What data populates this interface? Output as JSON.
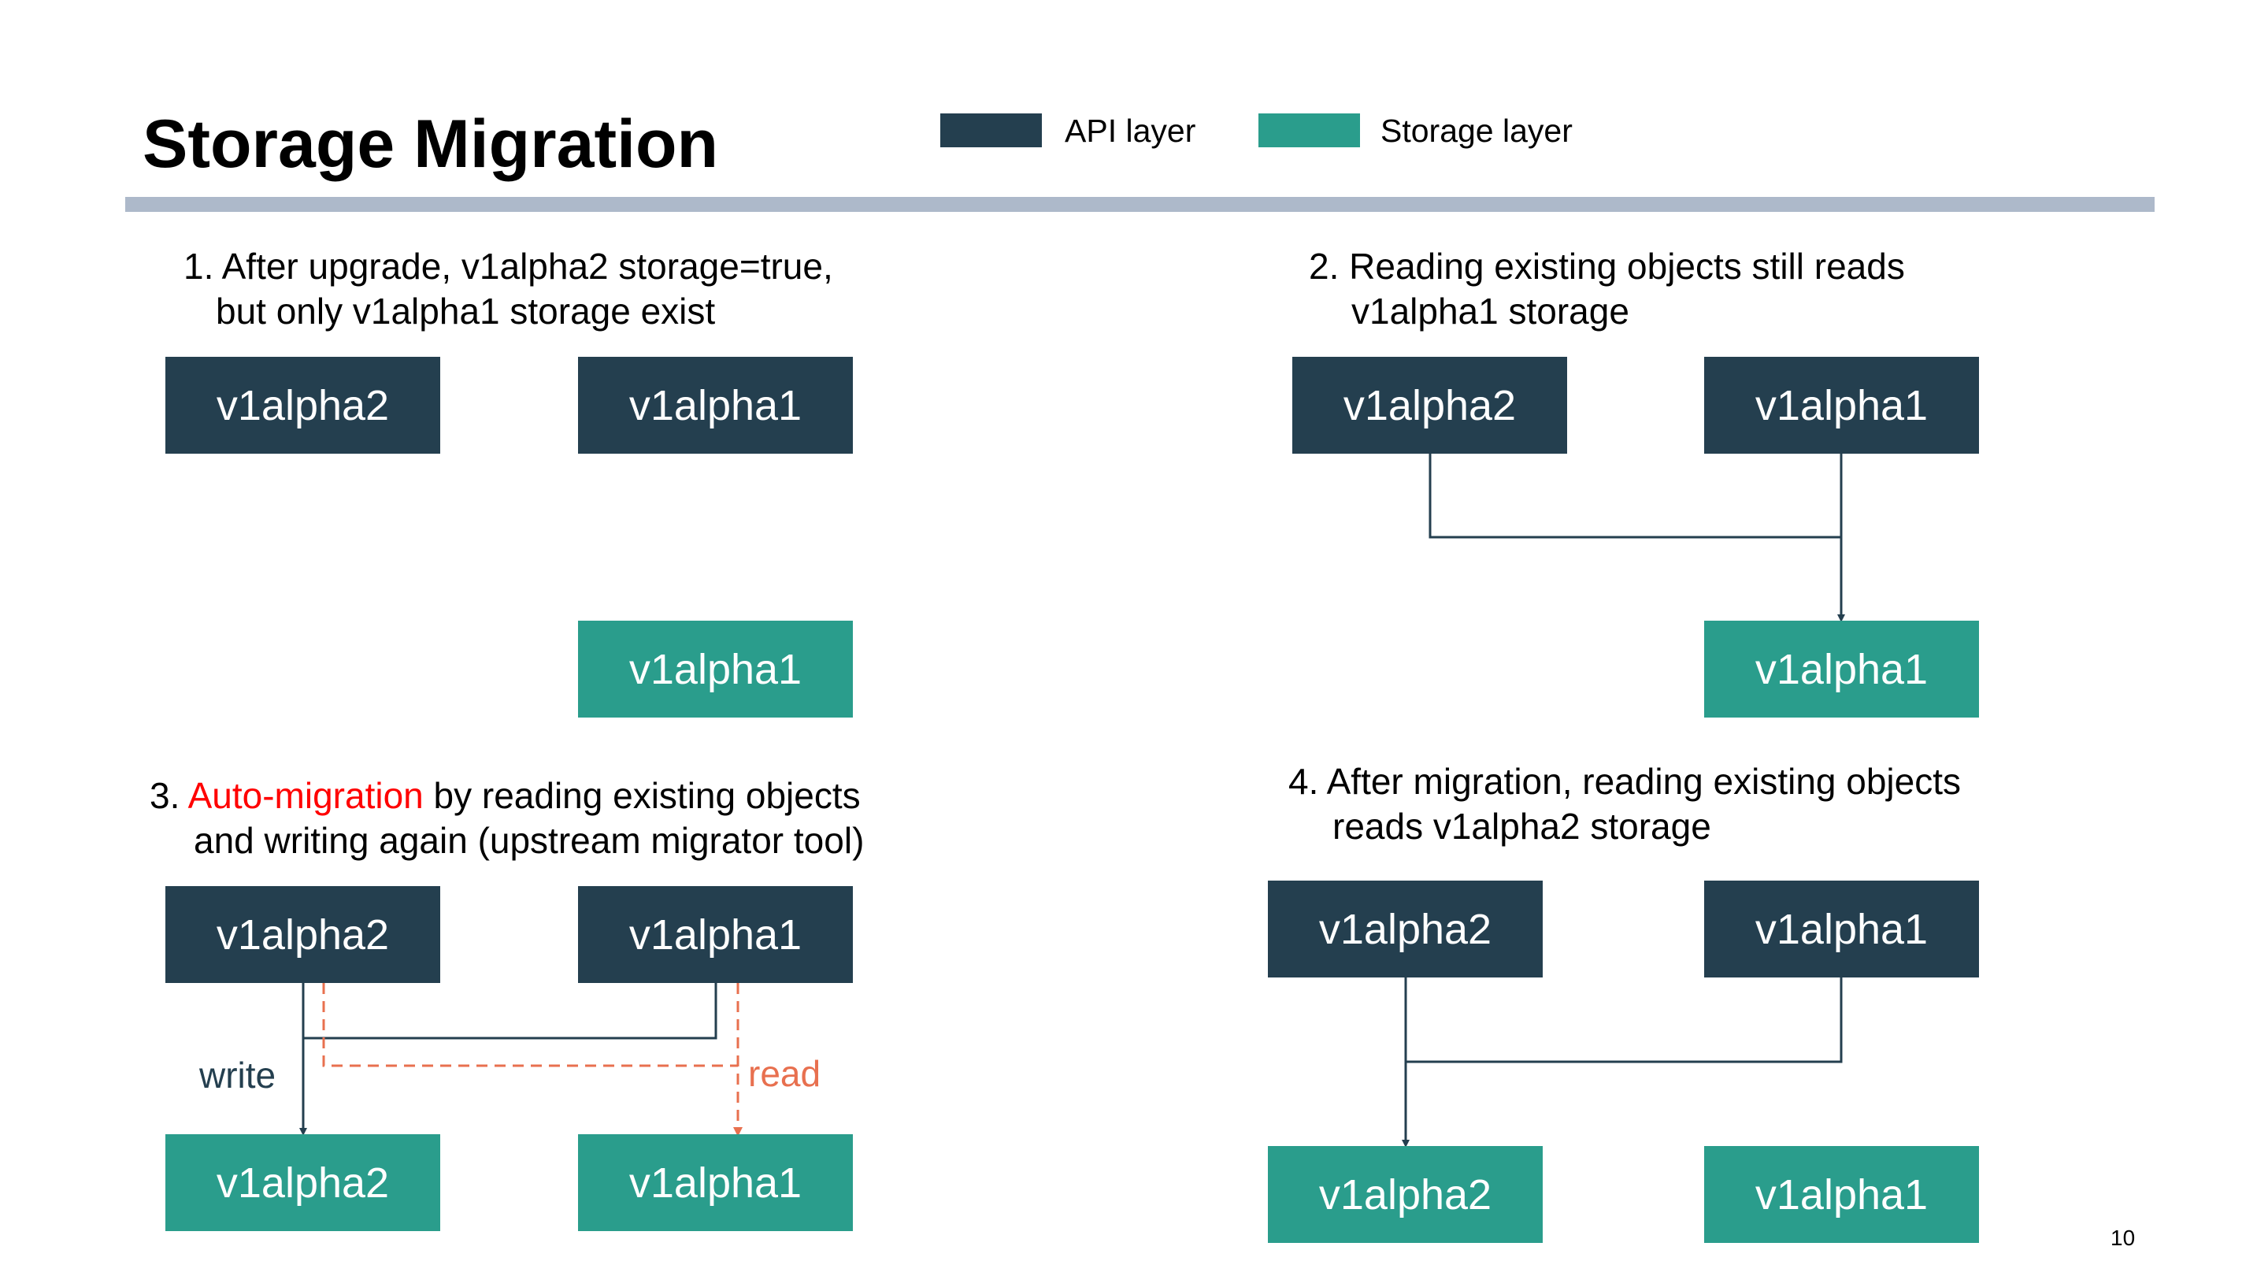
{
  "title": "Storage Migration",
  "legend": [
    {
      "label": "API layer",
      "color": "#243f4f"
    },
    {
      "label": "Storage layer",
      "color": "#2a9d8c"
    }
  ],
  "colors": {
    "api_layer": "#243f4f",
    "storage_layer": "#2a9d8c",
    "rule": "#adb9ca",
    "highlight_text": "#ff0000",
    "read_path": "#e8704f",
    "write_path": "#243f4f"
  },
  "panels": {
    "p1": {
      "caption_line1": "1. After upgrade, v1alpha2 storage=true,",
      "caption_line2": "but only v1alpha1 storage exist",
      "api_left": "v1alpha2",
      "api_right": "v1alpha1",
      "storage_right": "v1alpha1"
    },
    "p2": {
      "caption_line1": "2. Reading existing objects still reads",
      "caption_line2": "v1alpha1 storage",
      "api_left": "v1alpha2",
      "api_right": "v1alpha1",
      "storage_right": "v1alpha1"
    },
    "p3": {
      "caption_prefix": "3. ",
      "caption_highlight": "Auto-migration",
      "caption_rest": " by reading existing objects",
      "caption_line2": "and writing again (upstream migrator tool)",
      "api_left": "v1alpha2",
      "api_right": "v1alpha1",
      "storage_left": "v1alpha2",
      "storage_right": "v1alpha1",
      "write_label": "write",
      "read_label": "read"
    },
    "p4": {
      "caption_line1": "4. After migration, reading existing objects",
      "caption_line2": "reads v1alpha2 storage",
      "api_left": "v1alpha2",
      "api_right": "v1alpha1",
      "storage_left": "v1alpha2",
      "storage_right": "v1alpha1"
    }
  },
  "page_number": "10"
}
